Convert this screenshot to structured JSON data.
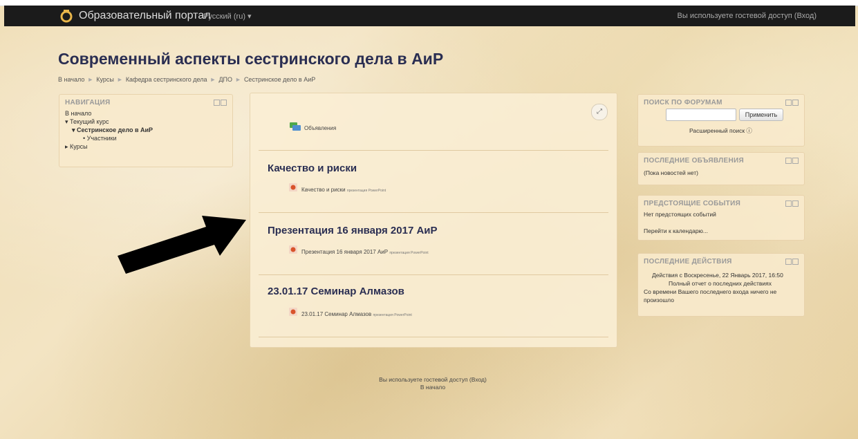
{
  "navbar": {
    "brand": "Образовательный портал",
    "language": "Русский (ru) ▾",
    "login_info": "Вы используете гостевой доступ (Вход)"
  },
  "page": {
    "title": "Современный аспекты сестринского дела в АиР",
    "breadcrumb": [
      "В начало",
      "Курсы",
      "Кафедра сестринского дела",
      "ДПО",
      "Сестринское дело в АиР"
    ]
  },
  "navigation": {
    "title": "НАВИГАЦИЯ",
    "items": [
      {
        "label": "В начало"
      },
      {
        "label": "▾ Текущий курс"
      },
      {
        "label": "▾ Сестринское дело в АиР"
      },
      {
        "label": "• Участники"
      },
      {
        "label": "▸ Курсы"
      }
    ]
  },
  "main": {
    "announcements": "Объявления",
    "sections": [
      {
        "title": "Качество и риски",
        "activity": "Качество и риски",
        "suffix": "презентация PowerPoint"
      },
      {
        "title": "Презентация 16 января 2017 АиР",
        "activity": "Презентация 16 января 2017 АиР",
        "suffix": "презентация PowerPoint"
      },
      {
        "title": "23.01.17 Семинар Алмазов",
        "activity": "23.01.17 Семинар Алмазов",
        "suffix": "презентация PowerPoint"
      }
    ]
  },
  "forum_search": {
    "title": "ПОИСК ПО ФОРУМАМ",
    "button": "Применить",
    "advanced": "Расширенный поиск ⓘ"
  },
  "news": {
    "title": "ПОСЛЕДНИЕ ОБЪЯВЛЕНИЯ",
    "text": "(Пока новостей нет)"
  },
  "events": {
    "title": "ПРЕДСТОЯЩИЕ СОБЫТИЯ",
    "none": "Нет предстоящих событий",
    "calendar_link": "Перейти к календарю..."
  },
  "activity": {
    "title": "ПОСЛЕДНИЕ ДЕЙСТВИЯ",
    "since": "Действия с Воскресенье, 22 Январь 2017, 16:50",
    "full_report": "Полный отчет о последних действиях",
    "none_line1": "Со времени Вашего последнего входа ничего не",
    "none_line2": "произошло"
  },
  "footer": {
    "login_info": "Вы используете гостевой доступ (Вход)",
    "home": "В начало"
  }
}
